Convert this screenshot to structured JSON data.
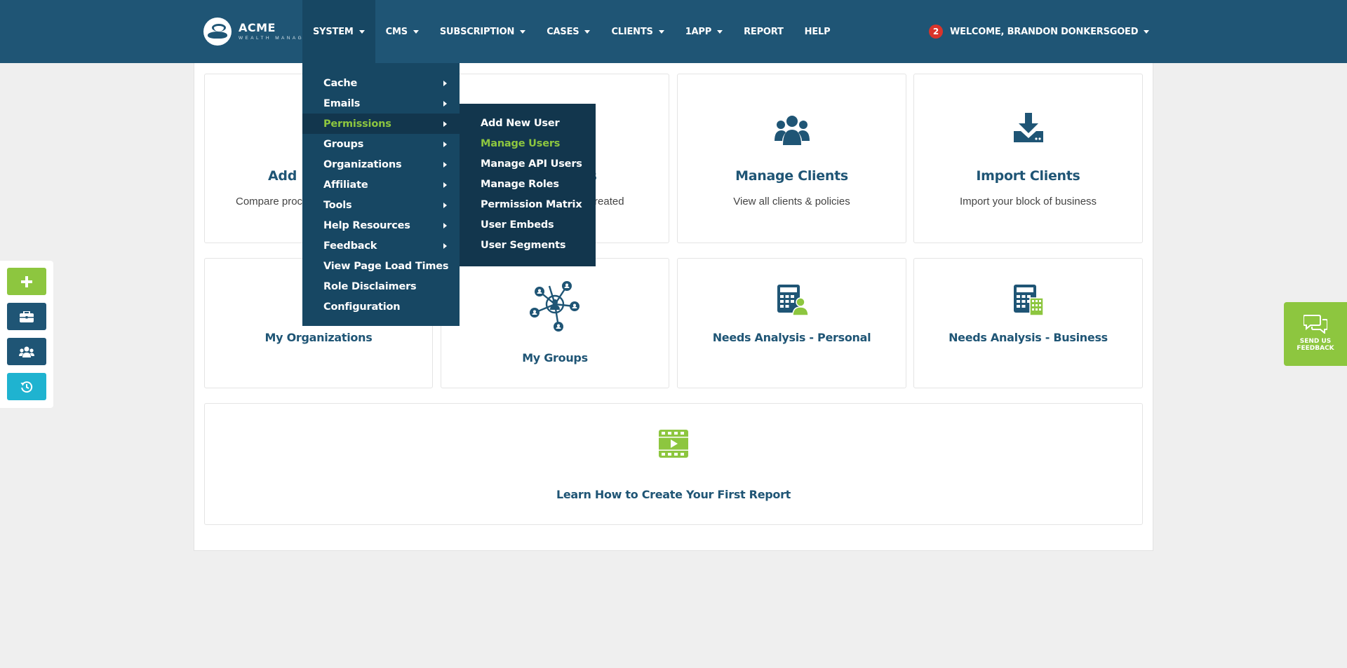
{
  "brand": {
    "name": "ACME",
    "tagline": "WEALTH MANAGEMENT"
  },
  "nav": {
    "items": [
      {
        "label": "SYSTEM",
        "dropdown": true
      },
      {
        "label": "CMS",
        "dropdown": true
      },
      {
        "label": "SUBSCRIPTION",
        "dropdown": true
      },
      {
        "label": "CASES",
        "dropdown": true
      },
      {
        "label": "CLIENTS",
        "dropdown": true
      },
      {
        "label": "1APP",
        "dropdown": true
      },
      {
        "label": "REPORT",
        "dropdown": false
      },
      {
        "label": "HELP",
        "dropdown": false
      }
    ]
  },
  "user": {
    "notification_count": "2",
    "welcome": "WELCOME, BRANDON DONKERSGOED"
  },
  "system_menu": {
    "items": [
      {
        "label": "Cache",
        "submenu": true
      },
      {
        "label": "Emails",
        "submenu": true
      },
      {
        "label": "Permissions",
        "submenu": true,
        "highlighted": true
      },
      {
        "label": "Groups",
        "submenu": true
      },
      {
        "label": "Organizations",
        "submenu": true
      },
      {
        "label": "Affiliate",
        "submenu": true
      },
      {
        "label": "Tools",
        "submenu": true
      },
      {
        "label": "Help Resources",
        "submenu": true
      },
      {
        "label": "Feedback",
        "submenu": true
      },
      {
        "label": "View Page Load Times",
        "submenu": false
      },
      {
        "label": "Role Disclaimers",
        "submenu": false
      },
      {
        "label": "Configuration",
        "submenu": false
      }
    ]
  },
  "permissions_submenu": {
    "items": [
      {
        "label": "Add New User"
      },
      {
        "label": "Manage Users",
        "highlighted": true
      },
      {
        "label": "Manage API Users"
      },
      {
        "label": "Manage Roles"
      },
      {
        "label": "Permission Matrix"
      },
      {
        "label": "User Embeds"
      },
      {
        "label": "User Segments"
      }
    ]
  },
  "cards": {
    "add": {
      "title_visible": "Add I",
      "desc_visible": "Compare proc"
    },
    "policies": {
      "title_visible": "es",
      "desc_visible": "e created"
    },
    "manage_clients": {
      "title": "Manage Clients",
      "desc": "View all clients & policies",
      "icon": "users-group-icon"
    },
    "import_clients": {
      "title": "Import Clients",
      "desc": "Import your block of business",
      "icon": "download-tray-icon"
    },
    "my_organizations": {
      "title": "My Organizations"
    },
    "my_groups": {
      "title": "My Groups",
      "icon": "network-people-icon"
    },
    "needs_personal": {
      "title": "Needs Analysis - Personal",
      "icon": "calculator-person-icon"
    },
    "needs_business": {
      "title": "Needs Analysis - Business",
      "icon": "calculator-building-icon"
    },
    "learn_report": {
      "title": "Learn How to Create Your First Report",
      "icon": "video-film-icon"
    }
  },
  "quickbar": {
    "buttons": [
      {
        "icon": "plus-icon",
        "color": "#8dc63f"
      },
      {
        "icon": "briefcase-icon",
        "color": "#1f5575"
      },
      {
        "icon": "users-icon",
        "color": "#1f5575"
      },
      {
        "icon": "history-icon",
        "color": "#1fb3d0"
      }
    ]
  },
  "feedback": {
    "line1": "SEND US",
    "line2": "FEEDBACK"
  },
  "colors": {
    "primary": "#1f5575",
    "accent": "#8dc63f",
    "teal": "#1fb3d0",
    "badge": "#d9342b"
  }
}
